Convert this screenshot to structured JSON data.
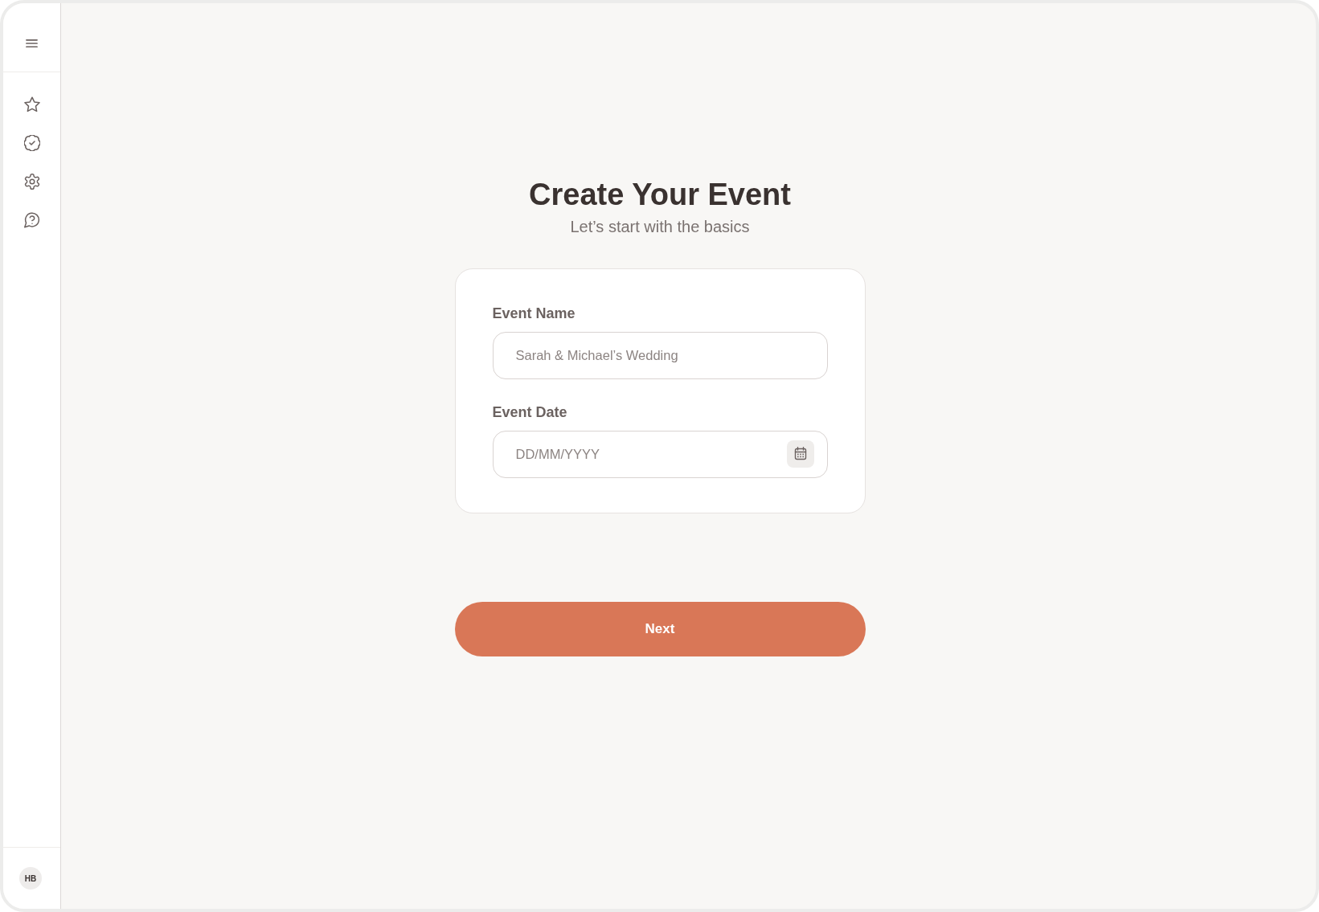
{
  "sidebar": {
    "avatar": {
      "initials": "HB"
    }
  },
  "header": {
    "title": "Create Your Event",
    "subtitle": "Let’s start with the basics"
  },
  "form": {
    "fields": [
      {
        "kind": "text",
        "label": "Event Name",
        "placeholder": "Sarah & Michael’s Wedding"
      },
      {
        "kind": "date",
        "label": "Event Date",
        "placeholder": "DD/MM/YYYY"
      }
    ]
  },
  "next_button": {
    "label": "Next"
  }
}
